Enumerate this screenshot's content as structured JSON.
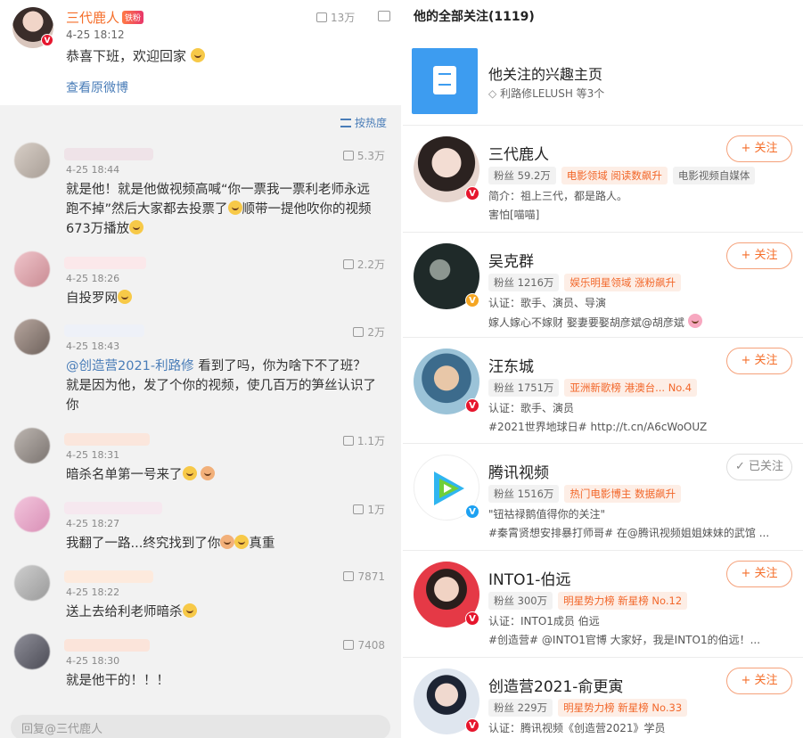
{
  "post": {
    "author": "三代鹿人",
    "tag": "铁粉",
    "time": "4-25 18:12",
    "likes": "13万",
    "text": "恭喜下班，欢迎回家",
    "view_original": "查看原微博"
  },
  "sort_label": "按热度",
  "comments": [
    {
      "time": "4-25 18:44",
      "likes": "5.3万",
      "text": "就是他！就是他做视频高喊“你一票我一票利老师永远跑不掉”然后大家都去投票了",
      "text_tail": "顺带一提他吹你的视频673万播放"
    },
    {
      "time": "4-25 18:26",
      "likes": "2.2万",
      "text": "自投罗网"
    },
    {
      "time": "4-25 18:43",
      "likes": "2万",
      "mention": "@创造营2021-利路修",
      "text": " 看到了吗，你为啥下不了班？就是因为他，发了个你的视频，使几百万的笋丝认识了你"
    },
    {
      "time": "4-25 18:31",
      "likes": "1.1万",
      "text": "暗杀名单第一号来了"
    },
    {
      "time": "4-25 18:27",
      "likes": "1万",
      "text": "我翻了一路...终究找到了你",
      "text_tail": "真重"
    },
    {
      "time": "4-25 18:22",
      "likes": "7871",
      "text": "送上去给利老师暗杀"
    },
    {
      "time": "4-25 18:30",
      "likes": "7408",
      "text": "就是他干的！！！"
    }
  ],
  "reply_placeholder": "回复@三代鹿人",
  "right": {
    "title": "他的全部关注(1119)",
    "interest": {
      "title": "他关注的兴趣主页",
      "sub": "利路修LELUSH 等3个"
    },
    "users": [
      {
        "name": "三代鹿人",
        "follow": "+ 关注",
        "fans": "粉丝 59.2万",
        "chip1": "电影领域 阅读数飙升",
        "chip2": "电影视频自媒体",
        "l1": "简介：祖上三代，都是路人。",
        "l2": "害怕[喵喵]",
        "avatar_color": "#e9d3cc",
        "badge": "red"
      },
      {
        "name": "吴克群",
        "follow": "+ 关注",
        "fans": "粉丝 1216万",
        "chip1": "娱乐明星领域 涨粉飙升",
        "chip2": "",
        "l1": "认证：歌手、演员、导演",
        "l2": "嫁人嫁心不嫁财 娶妻要娶胡彦斌@胡彦斌",
        "avatar_color": "#1e2b2a",
        "badge": "gold"
      },
      {
        "name": "汪东城",
        "follow": "+ 关注",
        "fans": "粉丝 1751万",
        "chip1": "亚洲新歌榜 港澳台... No.4",
        "chip2": "",
        "l1": "认证：歌手、演员",
        "l2": "#2021世界地球日# http://t.cn/A6cWoOUZ",
        "avatar_color": "#6fa8c9",
        "badge": "red"
      },
      {
        "name": "腾讯视频",
        "follow": "✓ 已关注",
        "fans": "粉丝 1516万",
        "chip1": "热门电影博主 数据飙升",
        "chip2": "",
        "l1": "\"钮祜禄鹅值得你的关注\"",
        "l2": "#秦霄贤想安排暴打师哥# 在@腾讯视频姐姐妹妹的武馆 ...",
        "avatar_color": "#ffffff",
        "badge": "blue"
      },
      {
        "name": "INTO1-伯远",
        "follow": "+ 关注",
        "fans": "粉丝 300万",
        "chip1": "明星势力榜 新星榜 No.12",
        "chip2": "",
        "l1": "认证：INTO1成员 伯远",
        "l2": "#创造营# @INTO1官博 大家好，我是INTO1的伯远！...",
        "avatar_color": "#e53946",
        "badge": "red"
      },
      {
        "name": "创造营2021-俞更寅",
        "follow": "+ 关注",
        "fans": "粉丝 229万",
        "chip1": "明星势力榜 新星榜 No.33",
        "chip2": "",
        "l1": "认证：腾讯视频《创造营2021》学员",
        "l2": "",
        "avatar_color": "#dfe6ef",
        "badge": "red"
      }
    ]
  }
}
